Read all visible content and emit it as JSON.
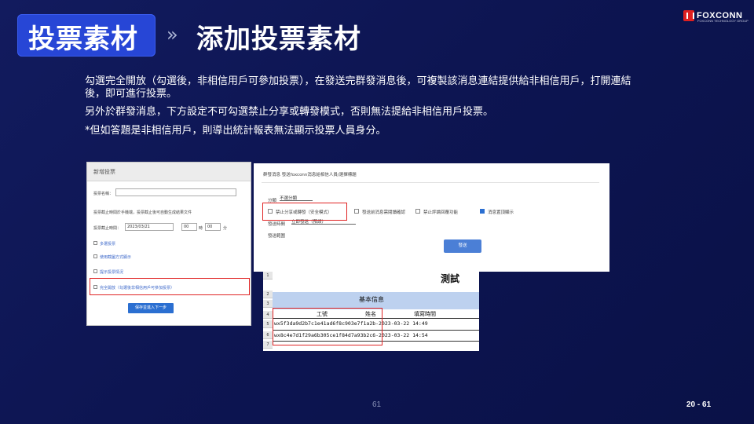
{
  "header": {
    "title": "投票素材",
    "subtitle": "添加投票素材",
    "arrow": "»"
  },
  "logo": {
    "text": "FOXCONN",
    "sub": "FOXCONN TECHNOLOGY GROUP"
  },
  "paragraphs": [
    "勾選完全開放（勾選後，非相信用戶可參加投票），在發送完群發消息後，可複製該消息連結提供給非相信用戶，打開連結後，即可進行投票。",
    "另外於群發消息，下方設定不可勾選禁止分享或轉發模式，否則無法提給非相信用戶投票。",
    "*但如答題是非相信用戶，則導出統計報表無法顯示投票人員身分。"
  ],
  "form_shot": {
    "title": "新增投票",
    "name_label": "投票名稱：",
    "desc": "投票截止時間於手機端，投票截止後可自動生成結果文件",
    "deadline_label": "投票截止時間：",
    "deadline_value": "2023/03/21",
    "hour": "00",
    "minute": "00",
    "minute_unit": "分",
    "hour_unit": "時",
    "options": [
      "多選投票",
      "使用截圖方式顯示",
      "提示投票情況",
      "完全開放（勾選後非相信用戶可參加投票）"
    ],
    "submit": "保存並進入下一步"
  },
  "settings_shot": {
    "heading": "群發消息 發送foxconn消息給相信人員/選擇標題",
    "type_label": "分類",
    "type_value": "不選分類",
    "opt_forbid": "禁止分享或轉發（安全模式）",
    "opt_read": "發送前消息需閱讀確認",
    "opt_comment": "禁止評論回覆功能",
    "opt_top": "消息置頂顯示",
    "send_time_label": "發送時間",
    "send_time_value": "立即發送（預設）",
    "scope": "發送範圍",
    "submit": "發送"
  },
  "sheet_shot": {
    "title": "測試",
    "band": "基本信息",
    "row_numbers": [
      "1",
      "2",
      "3",
      "4",
      "5",
      "6",
      "7"
    ],
    "columns": [
      "工號",
      "姓名",
      "填寫時間"
    ],
    "rows": [
      "wx5f3da9d2b7c1e41ad6f8c903e7f1a2b-2023-03-22 14:49",
      "wx8c4e7d1f29a6b305ce1f84d7a93b2c6-2023-03-22 14:54"
    ]
  },
  "footer": {
    "page": "61",
    "ref": "20 - 61"
  }
}
